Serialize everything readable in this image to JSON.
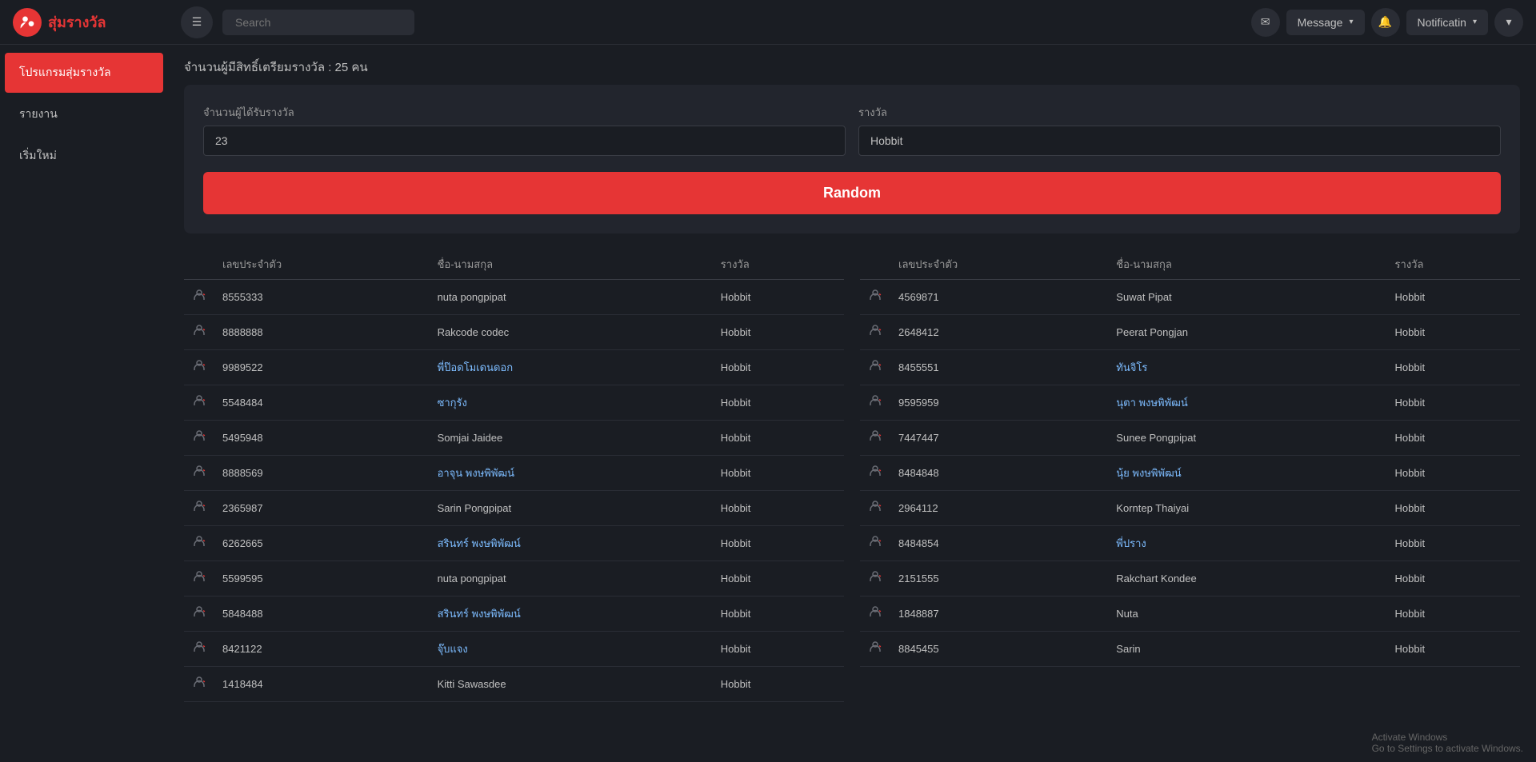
{
  "topnav": {
    "logo_text": "สุ่มรางวัล",
    "hamburger_icon": "☰",
    "search_placeholder": "Search",
    "message_label": "Message",
    "notification_label": "Notificatin",
    "message_icon": "✉",
    "bell_icon": "🔔",
    "chevron": "▾"
  },
  "sidebar": {
    "items": [
      {
        "id": "program",
        "label": "โปรแกรมสุ่มรางวัล",
        "active": true
      },
      {
        "id": "report",
        "label": "รายงาน",
        "active": false
      },
      {
        "id": "new",
        "label": "เริ่มใหม่",
        "active": false
      }
    ]
  },
  "page": {
    "subtitle": "จำนวนผู้มีสิทธิ์เตรียมรางวัล : 25 คน",
    "count_label": "จำนวนผู้ได้รับรางวัล",
    "prize_label": "รางวัล",
    "count_value": "23",
    "prize_value": "Hobbit",
    "random_button": "Random"
  },
  "table_left": {
    "headers": [
      "",
      "เลขประจำตัว",
      "ชื่อ-นามสกุล",
      "รางวัล"
    ],
    "rows": [
      {
        "id_num": "8555333",
        "name": "nuta pongpipat",
        "prize": "Hobbit",
        "name_thai": false
      },
      {
        "id_num": "8888888",
        "name": "Rakcode codec",
        "prize": "Hobbit",
        "name_thai": false
      },
      {
        "id_num": "9989522",
        "name": "พี่ป๊อดโมเดนดอก",
        "prize": "Hobbit",
        "name_thai": true
      },
      {
        "id_num": "5548484",
        "name": "ซากุรัง",
        "prize": "Hobbit",
        "name_thai": true
      },
      {
        "id_num": "5495948",
        "name": "Somjai Jaidee",
        "prize": "Hobbit",
        "name_thai": false
      },
      {
        "id_num": "8888569",
        "name": "อาจุน พงษพิพัฒน์",
        "prize": "Hobbit",
        "name_thai": true
      },
      {
        "id_num": "2365987",
        "name": "Sarin Pongpipat",
        "prize": "Hobbit",
        "name_thai": false
      },
      {
        "id_num": "6262665",
        "name": "สรินทร์ พงษพิพัฒน์",
        "prize": "Hobbit",
        "name_thai": true
      },
      {
        "id_num": "5599595",
        "name": "nuta pongpipat",
        "prize": "Hobbit",
        "name_thai": false
      },
      {
        "id_num": "5848488",
        "name": "สรินทร์ พงษพิพัฒน์",
        "prize": "Hobbit",
        "name_thai": true
      },
      {
        "id_num": "8421122",
        "name": "จุ๊บแจง",
        "prize": "Hobbit",
        "name_thai": true
      },
      {
        "id_num": "1418484",
        "name": "Kitti Sawasdee",
        "prize": "Hobbit",
        "name_thai": false
      }
    ]
  },
  "table_right": {
    "headers": [
      "",
      "เลขประจำตัว",
      "ชื่อ-นามสกุล",
      "รางวัล"
    ],
    "rows": [
      {
        "id_num": "4569871",
        "name": "Suwat Pipat",
        "prize": "Hobbit",
        "name_thai": false
      },
      {
        "id_num": "2648412",
        "name": "Peerat Pongjan",
        "prize": "Hobbit",
        "name_thai": false
      },
      {
        "id_num": "8455551",
        "name": "ทันจิโร",
        "prize": "Hobbit",
        "name_thai": true
      },
      {
        "id_num": "9595959",
        "name": "นุตา พงษพิพัฒน์",
        "prize": "Hobbit",
        "name_thai": true
      },
      {
        "id_num": "7447447",
        "name": "Sunee Pongpipat",
        "prize": "Hobbit",
        "name_thai": false
      },
      {
        "id_num": "8484848",
        "name": "นุ้ย พงษพิพัฒน์",
        "prize": "Hobbit",
        "name_thai": true
      },
      {
        "id_num": "2964112",
        "name": "Korntep Thaiyai",
        "prize": "Hobbit",
        "name_thai": false
      },
      {
        "id_num": "8484854",
        "name": "พี่ปราง",
        "prize": "Hobbit",
        "name_thai": true
      },
      {
        "id_num": "2151555",
        "name": "Rakchart Kondee",
        "prize": "Hobbit",
        "name_thai": false
      },
      {
        "id_num": "1848887",
        "name": "Nuta",
        "prize": "Hobbit",
        "name_thai": false
      },
      {
        "id_num": "8845455",
        "name": "Sarin",
        "prize": "Hobbit",
        "name_thai": false
      }
    ]
  },
  "watermark": {
    "line1": "Activate Windows",
    "line2": "Go to Settings to activate Windows."
  }
}
